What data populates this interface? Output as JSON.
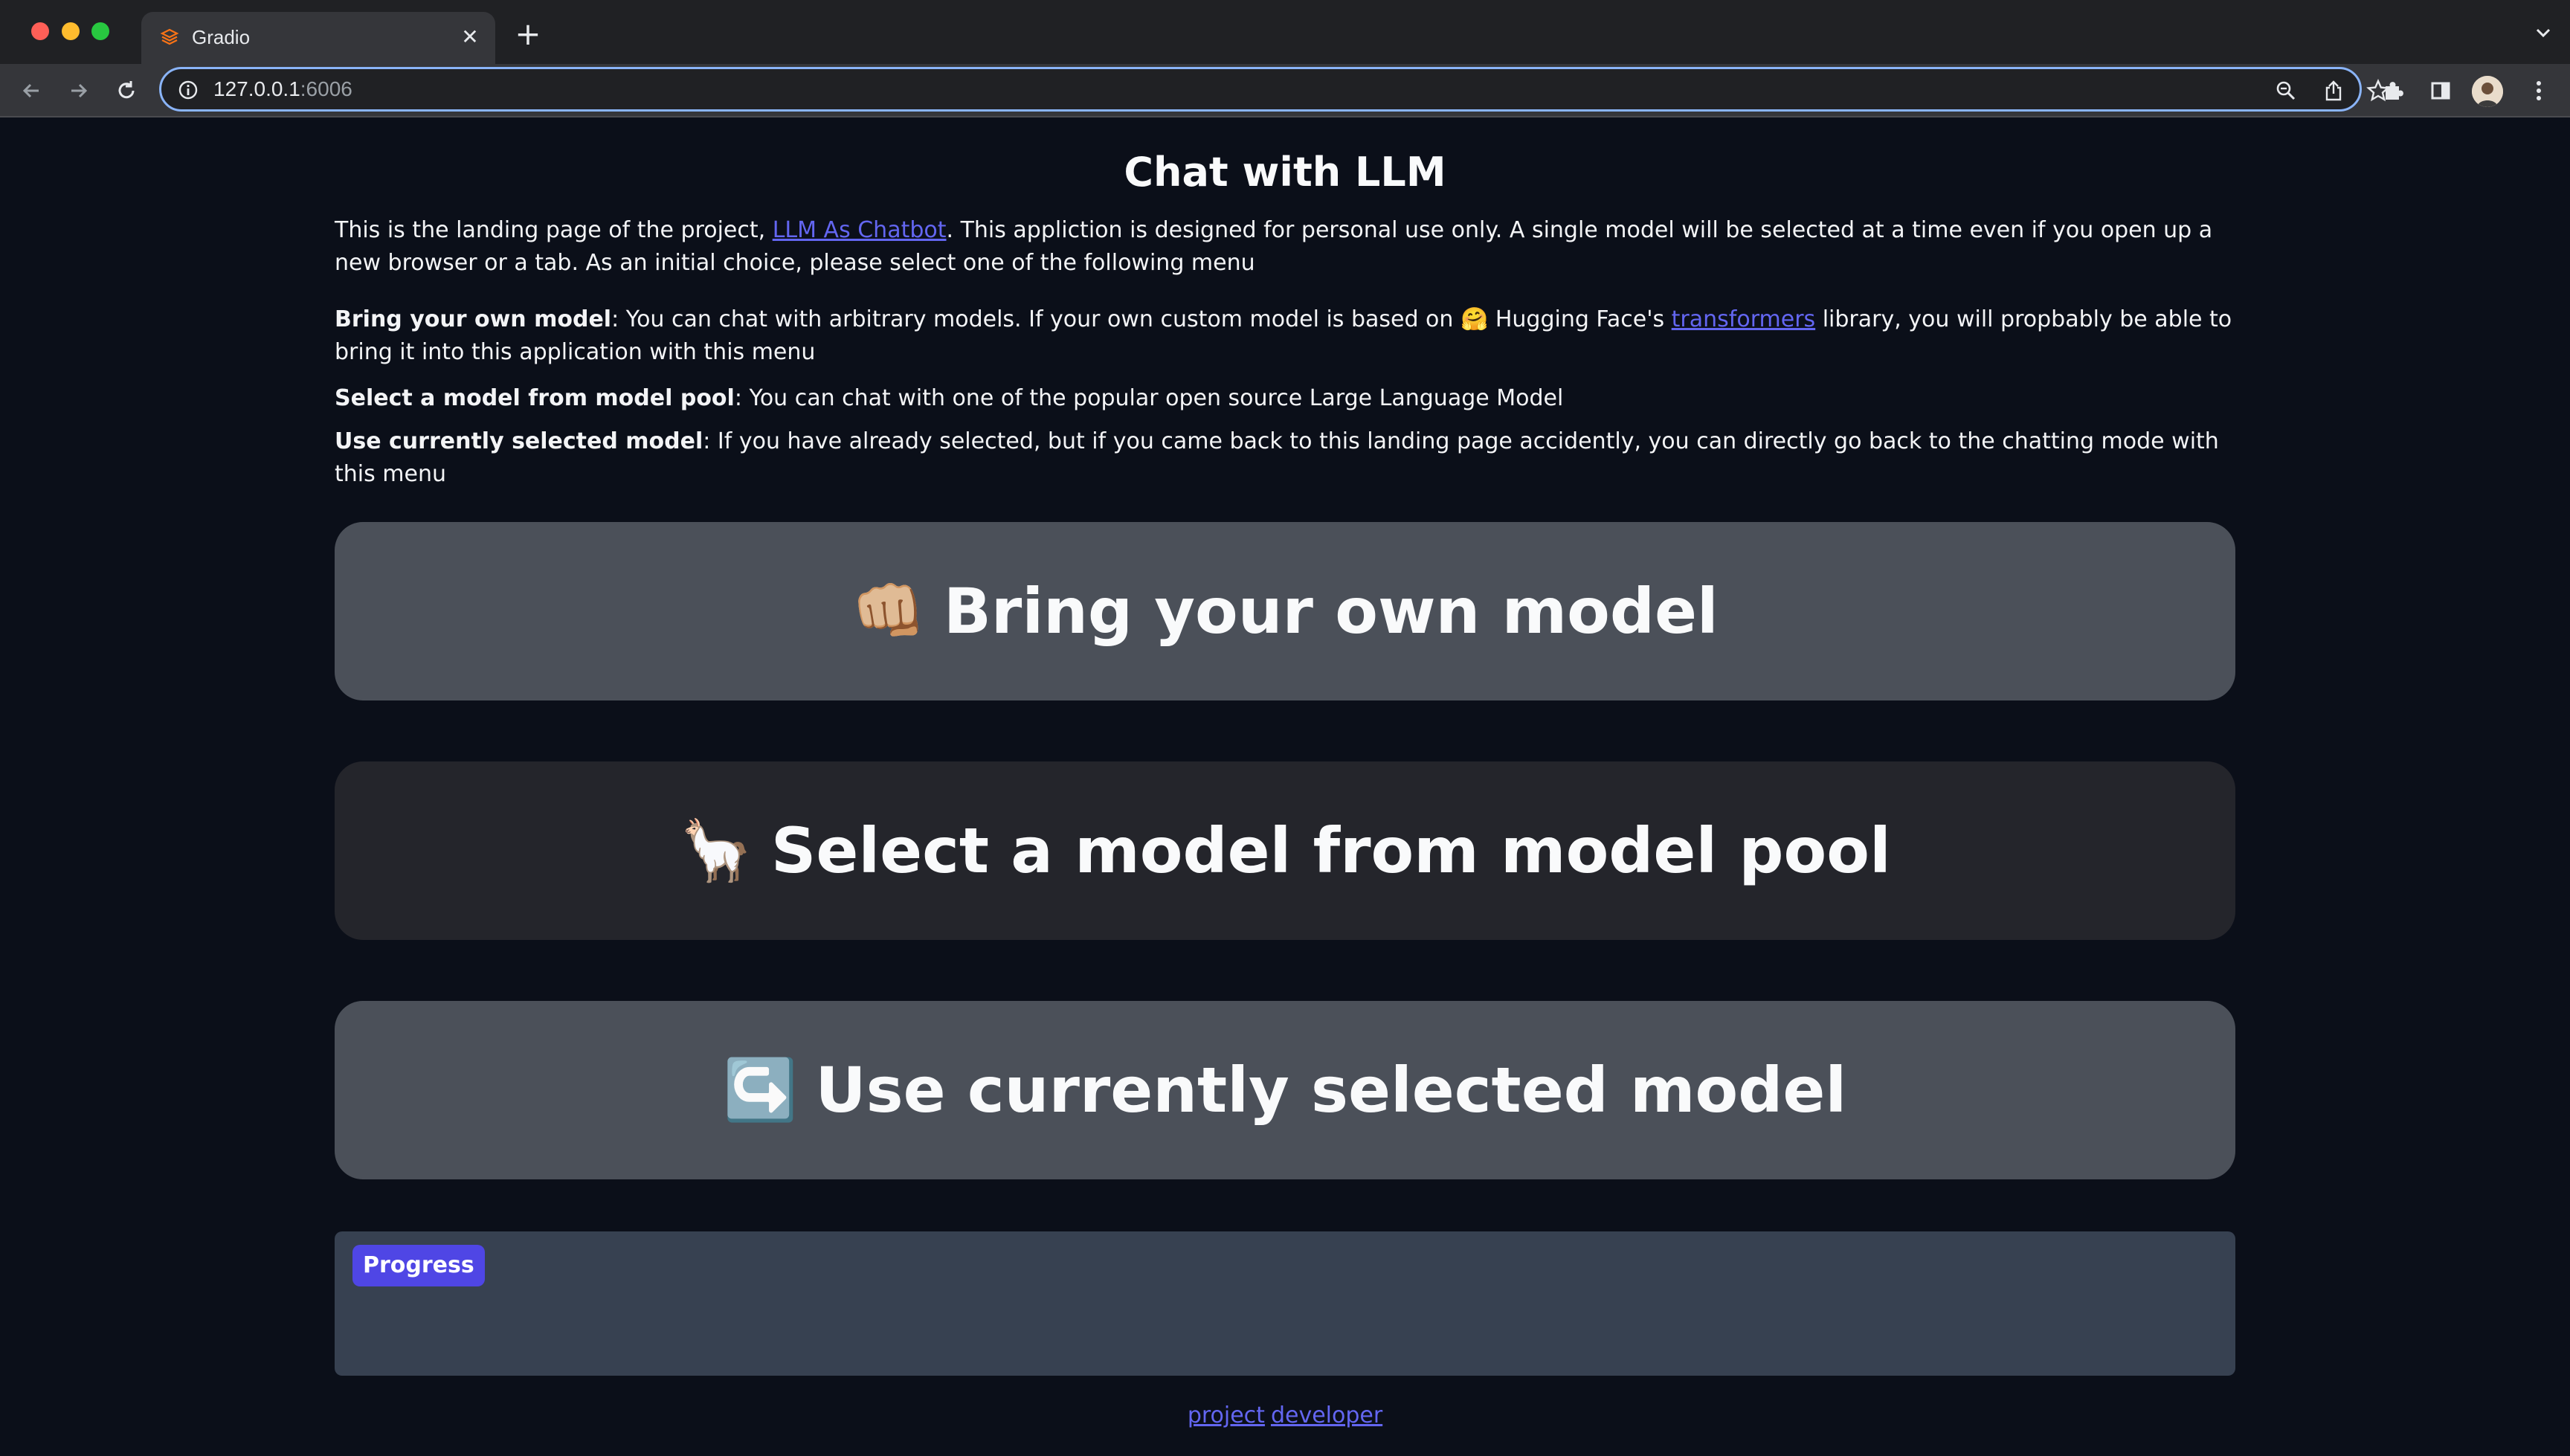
{
  "browser": {
    "tab_title": "Gradio",
    "url_host": "127.0.0.1",
    "url_port": ":6006"
  },
  "page": {
    "title": "Chat with LLM",
    "intro": {
      "before_link": "This is the landing page of the project, ",
      "link_text": "LLM As Chatbot",
      "after_link": ". This appliction is designed for personal use only. A single model will be selected at a time even if you open up a new browser or a tab. As an initial choice, please select one of the following menu"
    },
    "options": [
      {
        "bold": "Bring your own model",
        "text_before": ": You can chat with arbitrary models. If your own custom model is based on 🤗 Hugging Face's ",
        "link_text": "transformers",
        "text_after": " library, you will propbably be able to bring it into this application with this menu"
      },
      {
        "bold": "Select a model from model pool",
        "text": ": You can chat with one of the popular open source Large Language Model"
      },
      {
        "bold": "Use currently selected model",
        "text": ": If you have already selected, but if you came back to this landing page accidently, you can directly go back to the chatting mode with this menu"
      }
    ],
    "buttons": [
      {
        "emoji": "👊🏼",
        "label": "Bring your own model"
      },
      {
        "emoji": "🦙",
        "label": "Select a model from model pool"
      },
      {
        "emoji": "↪️",
        "label": "Use currently selected model"
      }
    ],
    "progress_label": "Progress",
    "footer": {
      "link1": "project",
      "link2": "developer"
    }
  },
  "colors": {
    "background": "#0b0f19",
    "button_primary": "#4b5059",
    "button_secondary": "#24252b",
    "accent": "#4f46e5",
    "link": "#6366f1"
  }
}
